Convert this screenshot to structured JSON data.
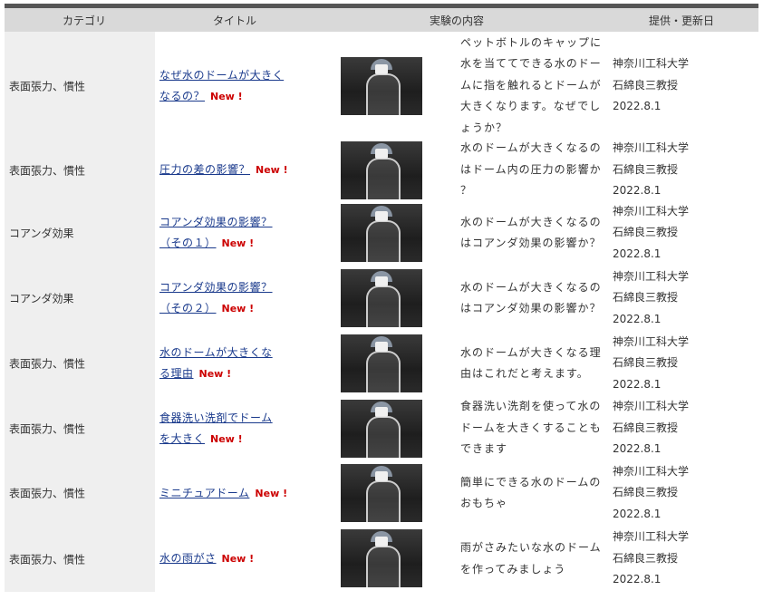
{
  "table": {
    "headers": {
      "category": "カテゴリ",
      "title": "タイトル",
      "content": "実験の内容",
      "provider": "提供・更新日"
    },
    "new_label": "New !",
    "rows": [
      {
        "category": "表面張力、慣性",
        "title": "なぜ水のドームが大きくなるの？",
        "description": "ペットボトルのキャップに水を当ててできる水のドームに指を触れるとドームが大きくなります。なぜでしょうか？",
        "provider_lines": [
          "神奈川工科大学",
          "石綿良三教授",
          "2022.8.1"
        ],
        "thumb_icon": "bottle-photo"
      },
      {
        "category": "表面張力、慣性",
        "title": "圧力の差の影響？",
        "description": "水のドームが大きくなるのはドーム内の圧力の影響か？",
        "provider_lines": [
          "神奈川工科大学",
          "石綿良三教授",
          "2022.8.1"
        ],
        "thumb_icon": "bottle-photo"
      },
      {
        "category": "コアンダ効果",
        "title": "コアンダ効果の影響？（その１）",
        "description": "水のドームが大きくなるのはコアンダ効果の影響か？",
        "provider_lines": [
          "神奈川工科大学",
          "石綿良三教授",
          "2022.8.1"
        ],
        "thumb_icon": "bottle-photo"
      },
      {
        "category": "コアンダ効果",
        "title": "コアンダ効果の影響？（その２）",
        "description": "水のドームが大きくなるのはコアンダ効果の影響か？",
        "provider_lines": [
          "神奈川工科大学",
          "石綿良三教授",
          "2022.8.1"
        ],
        "thumb_icon": "bottle-photo"
      },
      {
        "category": "表面張力、慣性",
        "title": "水のドームが大きくなる理由",
        "description": "水のドームが大きくなる理由はこれだと考えます。",
        "provider_lines": [
          "神奈川工科大学",
          "石綿良三教授",
          "2022.8.1"
        ],
        "thumb_icon": "bottle-photo"
      },
      {
        "category": "表面張力、慣性",
        "title": "食器洗い洗剤でドームを大きく",
        "description": "食器洗い洗剤を使って水のドームを大きくすることもできます",
        "provider_lines": [
          "神奈川工科大学",
          "石綿良三教授",
          "2022.8.1"
        ],
        "thumb_icon": "bottle-photo"
      },
      {
        "category": "表面張力、慣性",
        "title": "ミニチュアドーム",
        "description": "簡単にできる水のドームのおもちゃ",
        "provider_lines": [
          "神奈川工科大学",
          "石綿良三教授",
          "2022.8.1"
        ],
        "thumb_icon": "bottle-photo"
      },
      {
        "category": "表面張力、慣性",
        "title": "水の雨がさ",
        "description": "雨がさみたいな水のドームを作ってみましょう",
        "provider_lines": [
          "神奈川工科大学",
          "石綿良三教授",
          "2022.8.1"
        ],
        "thumb_icon": "bottle-photo"
      }
    ]
  }
}
